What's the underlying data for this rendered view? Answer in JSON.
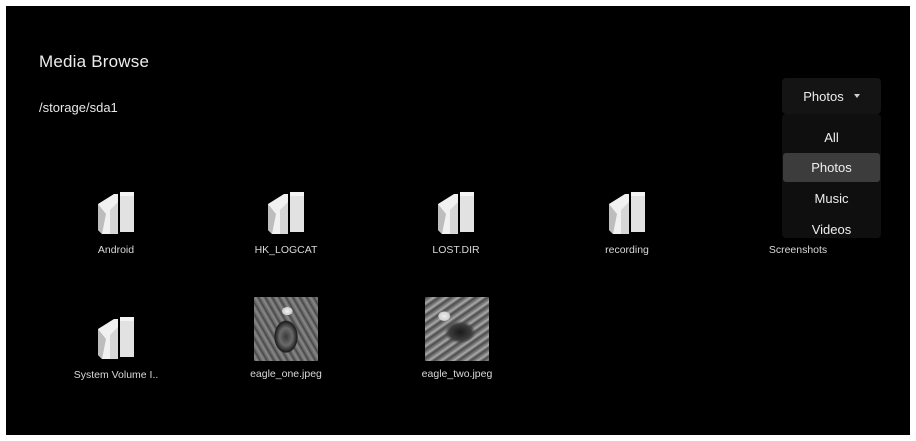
{
  "header": {
    "title": "Media Browse",
    "path": "/storage/sda1"
  },
  "filter": {
    "selected": "Photos",
    "options": [
      "All",
      "Photos",
      "Music",
      "Videos"
    ]
  },
  "items": [
    {
      "label": "Android",
      "type": "folder"
    },
    {
      "label": "HK_LOGCAT",
      "type": "folder"
    },
    {
      "label": "LOST.DIR",
      "type": "folder"
    },
    {
      "label": "recording",
      "type": "folder"
    },
    {
      "label": "Screenshots",
      "type": "folder"
    },
    {
      "label": "System Volume I..",
      "type": "folder"
    },
    {
      "label": "eagle_one.jpeg",
      "type": "image"
    },
    {
      "label": "eagle_two.jpeg",
      "type": "image"
    }
  ],
  "icons": {
    "folder": "folder-icon",
    "dropdown": "caret-down-icon"
  },
  "colors": {
    "background": "#000000",
    "text": "#ececec",
    "selected_option_bg": "#3c3c3c"
  }
}
